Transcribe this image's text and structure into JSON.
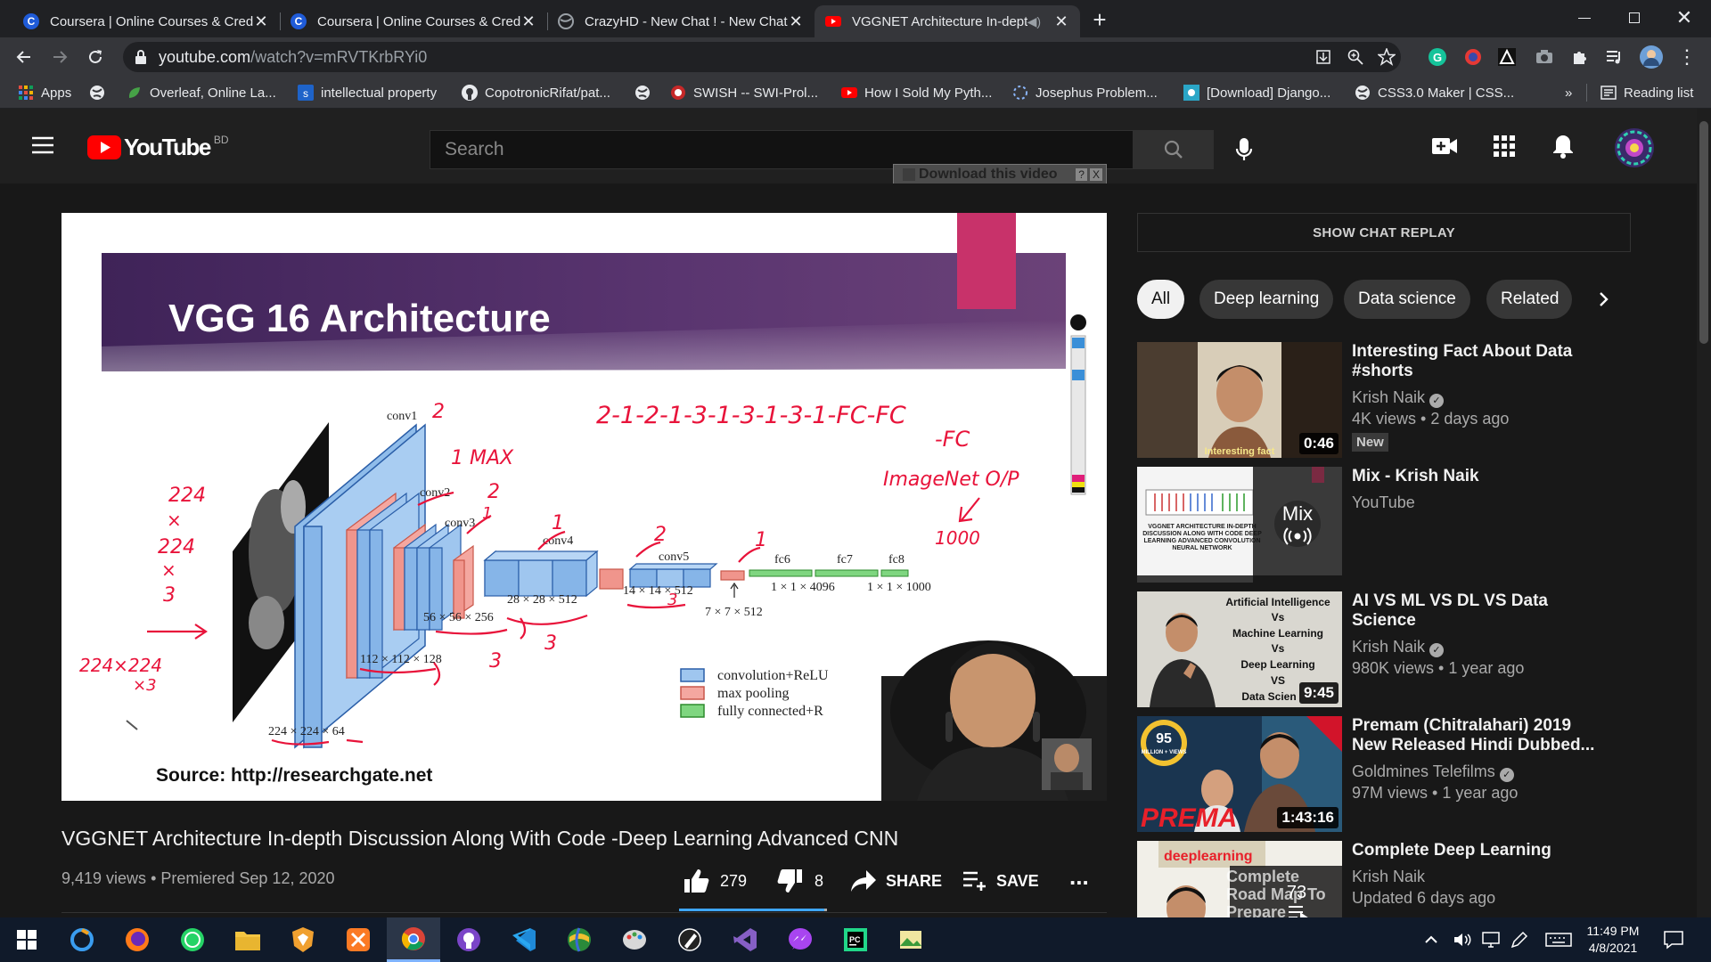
{
  "browser": {
    "tabs": [
      {
        "title": "Coursera | Online Courses & Credentials",
        "favicon": "coursera-icon",
        "active": false
      },
      {
        "title": "Coursera | Online Courses & Credentials",
        "favicon": "coursera-icon",
        "active": false
      },
      {
        "title": "CrazyHD - New Chat ! - New Chat",
        "favicon": "globe-icon",
        "active": false
      },
      {
        "title": "VGGNET Architecture In-depth",
        "favicon": "youtube-icon",
        "active": true
      }
    ],
    "url_host": "youtube.com",
    "url_path": "/watch?v=mRVTKrbRYi0",
    "bookmarks": [
      {
        "label": "Apps",
        "icon": "apps-grid-icon"
      },
      {
        "label": "",
        "icon": "globe-icon"
      },
      {
        "label": "Overleaf, Online La...",
        "icon": "overleaf-icon"
      },
      {
        "label": "intellectual property",
        "icon": "s-icon"
      },
      {
        "label": "CopotronicRifat/pat...",
        "icon": "github-icon"
      },
      {
        "label": "",
        "icon": "globe-icon"
      },
      {
        "label": "SWISH -- SWI-Prol...",
        "icon": "swish-icon"
      },
      {
        "label": "How I Sold My Pyth...",
        "icon": "youtube-icon"
      },
      {
        "label": "Josephus Problem...",
        "icon": "loading-icon"
      },
      {
        "label": "[Download] Django...",
        "icon": "image-icon"
      },
      {
        "label": "CSS3.0 Maker | CSS...",
        "icon": "globe-icon"
      }
    ],
    "bookmarks_more": "»",
    "reading_list": "Reading list"
  },
  "youtube": {
    "logo_text": "YouTube",
    "country": "BD",
    "search_placeholder": "Search",
    "download_bar": "Download this video",
    "download_help": "?",
    "download_close": "X",
    "video": {
      "title": "VGGNET Architecture In-depth Discussion Along With Code -Deep Learning Advanced CNN",
      "views": "9,419 views",
      "premiered": "Premiered Sep 12, 2020",
      "likes": "279",
      "dislikes": "8",
      "share": "SHARE",
      "save": "SAVE",
      "more": "..."
    },
    "slide": {
      "heading": "VGG 16 Architecture",
      "source": "Source: http://researchgate.net",
      "layers": {
        "conv1": "conv1",
        "conv2": "conv2",
        "conv3": "conv3",
        "conv4": "conv4",
        "conv5": "conv5",
        "fc6": "fc6",
        "fc7": "fc7",
        "fc8": "fc8"
      },
      "dims": {
        "d1": "224 × 224 × 64",
        "d2": "112 × 112 × 128",
        "d3": "56 × 56 × 256",
        "d4": "28 × 28 × 512",
        "d5": "14 × 14 × 512",
        "d6": "7 × 7 × 512",
        "d7": "1 × 1 × 4096",
        "d8": "1 × 1 × 1000"
      },
      "legend": [
        "convolution+ReLU",
        "max pooling",
        "fully connected+R"
      ],
      "hand": {
        "sequence1": "2-1-2-1-3-1-3-1-3-1-FC-FC",
        "sequence2": "-FC",
        "imagenet": "ImageNet O/P",
        "out": "1000",
        "input1": "224",
        "input2": "×",
        "input3": "224",
        "input4": "×",
        "input5": "3",
        "input6": "224×224",
        "input7": "×3",
        "c1": "2",
        "c2": "1 MAX",
        "c3": "2",
        "c4": "1",
        "c5": "1",
        "c6": "2",
        "c7": "1",
        "c8": "3",
        "c9": "3",
        "c10": "3"
      }
    },
    "chat_replay": "SHOW CHAT REPLAY",
    "chips": [
      {
        "label": "All",
        "active": true
      },
      {
        "label": "Deep learning",
        "active": false
      },
      {
        "label": "Data science",
        "active": false
      },
      {
        "label": "Related",
        "active": false
      }
    ],
    "recommendations": [
      {
        "title": "Interesting Fact About Data #shorts",
        "channel": "Krish Naik",
        "verified": true,
        "stats": "4K views • 2 days ago",
        "badge": "New",
        "duration": "0:46",
        "thumb_caption": "Interesting fact"
      },
      {
        "title": "Mix - Krish Naik",
        "channel": "YouTube",
        "verified": false,
        "stats": "",
        "badge": "",
        "duration": "",
        "mix_label": "Mix",
        "thumb_caption": "VGGNET ARCHITECTURE IN-DEPTH DISCUSSION ALONG WITH CODE DEEP LEARNING ADVANCED CONVOLUTION NEURAL NETWORK"
      },
      {
        "title": "AI VS ML VS DL VS Data Science",
        "channel": "Krish Naik",
        "verified": true,
        "stats": "980K views • 1 year ago",
        "badge": "",
        "duration": "9:45",
        "thumb_lines": [
          "Artificial Intelligence",
          "Vs",
          "Machine Learning",
          "Vs",
          "Deep Learning",
          "VS",
          "Data Scien"
        ]
      },
      {
        "title": "Premam (Chitralahari) 2019 New Released Hindi Dubbed...",
        "channel": "Goldmines Telefilms",
        "verified": true,
        "stats": "97M views • 1 year ago",
        "badge": "",
        "duration": "1:43:16",
        "thumb_caption": "PREMA",
        "thumb_badge_num": "95",
        "thumb_badge_text": "MILLION + VIEWS"
      },
      {
        "title": "Complete Deep Learning",
        "channel": "Krish Naik",
        "verified": false,
        "stats": "Updated 6 days ago",
        "badge": "",
        "duration": "",
        "playlist_count": "73",
        "thumb_caption": "Complete Road Map To Prepare",
        "thumb_tag": "deeplearning"
      }
    ]
  },
  "taskbar": {
    "time": "11:49 PM",
    "date": "4/8/2021"
  },
  "colors": {
    "yt_red": "#ff0000",
    "bg": "#181818",
    "header": "#202020",
    "chrome_dark": "#202124",
    "chrome_toolbar": "#35363a",
    "slide_purple": "#4a2a63",
    "ink_red": "#e8133a"
  }
}
